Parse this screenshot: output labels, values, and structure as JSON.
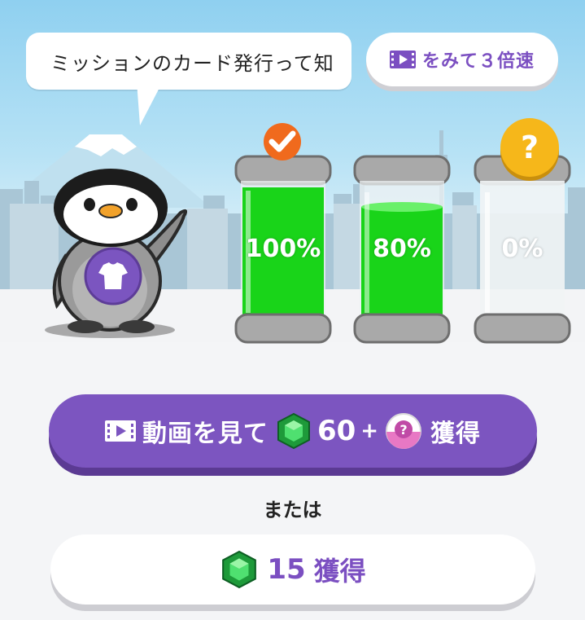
{
  "speech_bubble": {
    "text": "ミッションのカード発行って知"
  },
  "speed_button": {
    "label": "をみて３倍速",
    "icon": "video-icon"
  },
  "jars": [
    {
      "percent": 1.0,
      "label": "100%",
      "status": "complete",
      "badge_icon": "check-icon"
    },
    {
      "percent": 0.8,
      "label": "80%",
      "status": "in-progress"
    },
    {
      "percent": 0.0,
      "label": "0%",
      "status": "locked",
      "badge_icon": "question-icon",
      "badge_text": "?"
    }
  ],
  "mascot": {
    "name": "penguin",
    "belly_icon": "tshirt-icon"
  },
  "main_button": {
    "prefix": "動画を見て",
    "gem_count": "60",
    "plus": "+",
    "suffix": "獲得",
    "icons": [
      "video-icon",
      "emerald-gem-icon",
      "mystery-capsule-icon"
    ]
  },
  "or_text": "または",
  "alt_button": {
    "gem_count": "15",
    "suffix": "獲得",
    "icon": "emerald-gem-icon"
  },
  "colors": {
    "purple": "#7c55c0",
    "purple_text": "#7b4fc1",
    "green": "#18d318",
    "orange": "#f06a1d",
    "yellow": "#f6b71a"
  }
}
